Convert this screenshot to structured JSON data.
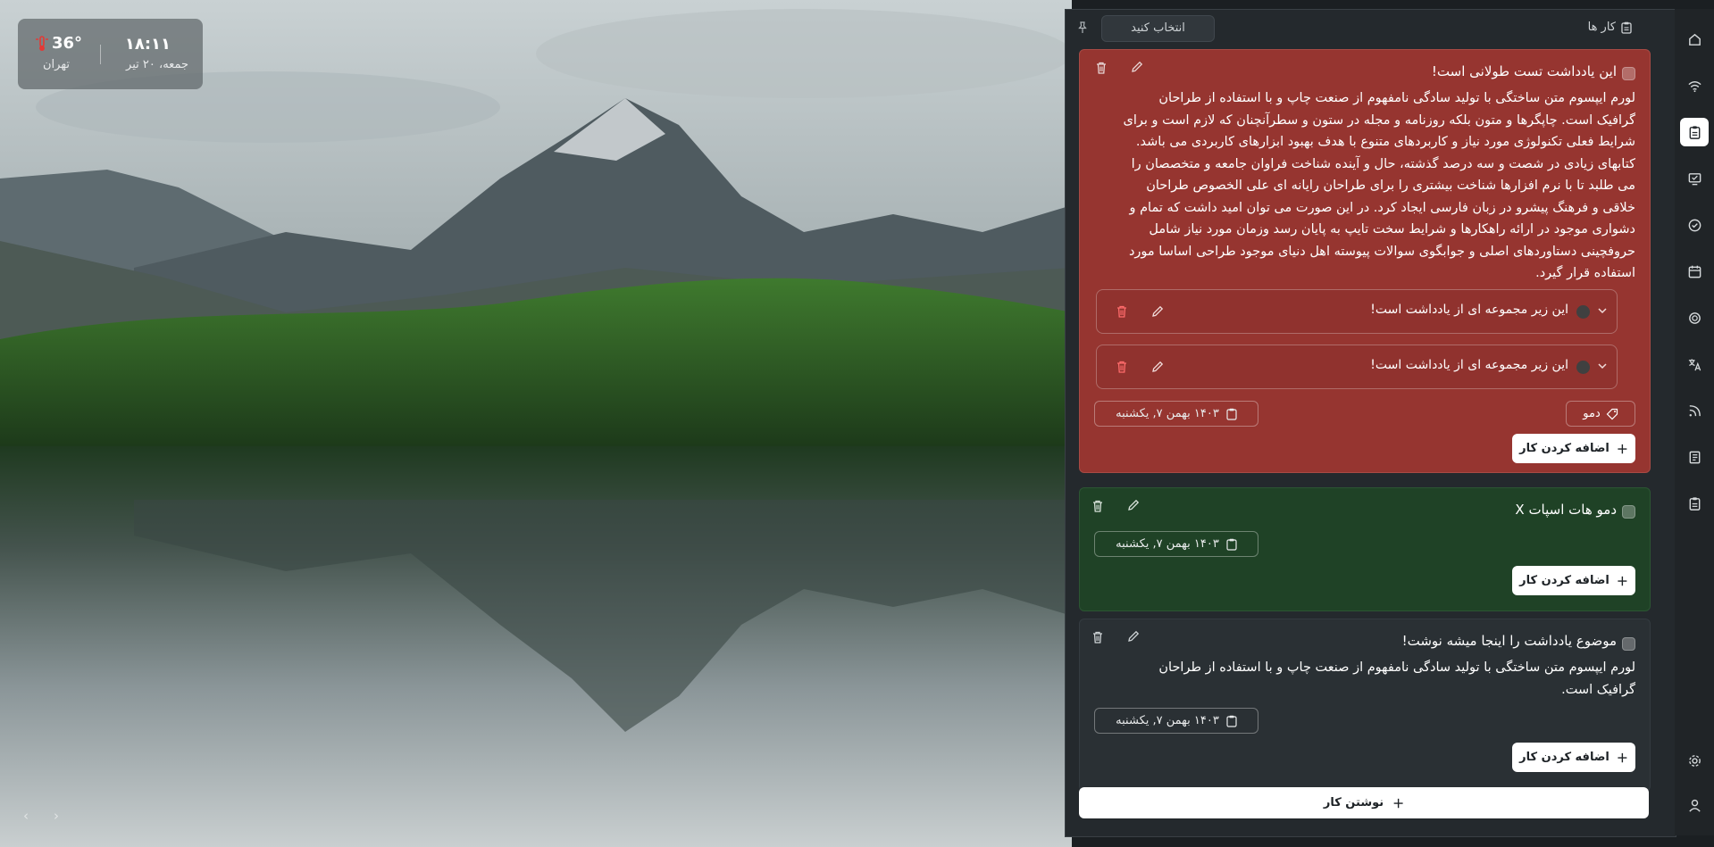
{
  "widget": {
    "time": "۱۸:۱۱",
    "date": "جمعه، ۲۰ تیر",
    "temperature": "36°",
    "city": "تهران"
  },
  "panel": {
    "title": "کار ها",
    "select_placeholder": "انتخاب کنید"
  },
  "cards": [
    {
      "title": "این یادداشت تست طولانی است!",
      "body": "لورم ایپسوم متن ساختگی با تولید سادگی نامفهوم از صنعت چاپ و با استفاده از طراحان گرافیک است. چاپگرها و متون بلکه روزنامه و مجله در ستون و سطرآنچنان که لازم است و برای شرایط فعلی تکنولوژی مورد نیاز و کاربردهای متنوع با هدف بهبود ابزارهای کاربردی می باشد. کتابهای زیادی در شصت و سه درصد گذشته، حال و آینده شناخت فراوان جامعه و متخصصان را می طلبد تا با نرم افزارها شناخت بیشتری را برای طراحان رایانه ای علی الخصوص طراحان خلاقی و فرهنگ پیشرو در زبان فارسی ایجاد کرد. در این صورت می توان امید داشت که تمام و دشواری موجود در ارائه راهکارها و شرایط سخت تایپ به پایان رسد وزمان مورد نیاز شامل حروفچینی دستاوردهای اصلی و جوابگوی سوالات پیوسته اهل دنیای موجود طراحی اساسا مورد استفاده قرار گیرد.",
      "subtasks": [
        {
          "label": "این زیر مجموعه ای از یادداشت است!"
        },
        {
          "label": "این زیر مجموعه ای از یادداشت است!"
        }
      ],
      "tag": "دمو",
      "date": "۱۴۰۳ بهمن ۷, یکشنبه",
      "add_label": "اضافه کردن کار",
      "color": "#963530"
    },
    {
      "title": "دمو هات اسپات X",
      "date": "۱۴۰۳ بهمن ۷, یکشنبه",
      "add_label": "اضافه کردن کار",
      "color": "#1f4226"
    },
    {
      "title": "موضوع یادداشت را اینجا میشه نوشت!",
      "body": "لورم ایپسوم متن ساختگی با تولید سادگی نامفهوم از صنعت چاپ و با استفاده از طراحان گرافیک است.",
      "date": "۱۴۰۳ بهمن ۷, یکشنبه",
      "add_label": "اضافه کردن کار",
      "color": "#2a3034"
    }
  ],
  "write_task_label": "نوشتن کار",
  "sidebar": {
    "items": [
      {
        "icon": "home-icon"
      },
      {
        "icon": "wifi-icon"
      },
      {
        "icon": "clipboard-icon",
        "active": true
      },
      {
        "icon": "monitor-check-icon"
      },
      {
        "icon": "check-circle-icon"
      },
      {
        "icon": "calendar-icon"
      },
      {
        "icon": "openai-icon"
      },
      {
        "icon": "translate-icon"
      },
      {
        "icon": "rss-icon"
      },
      {
        "icon": "notebook-icon"
      },
      {
        "icon": "clipboard-list-icon"
      },
      {
        "icon": "gear-icon"
      },
      {
        "icon": "user-icon"
      }
    ]
  }
}
